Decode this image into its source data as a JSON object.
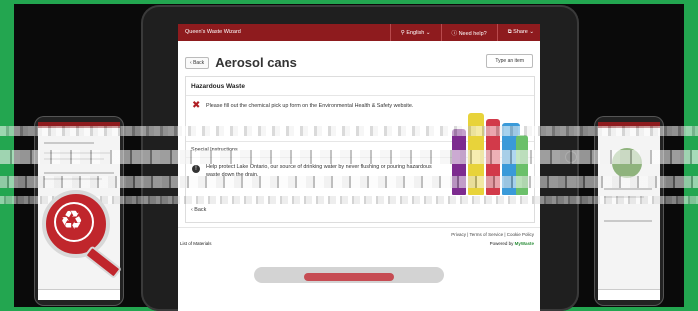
{
  "app": {
    "brand": "Queen's Waste Wizard",
    "language": "English",
    "help": "Need help?",
    "share": "Share"
  },
  "page": {
    "back_label": "Back",
    "title": "Aerosol cans",
    "type_an_item": "Type an item"
  },
  "card": {
    "section_title": "Hazardous Waste",
    "hazard_text": "Please fill out the chemical pick up form on the Environmental Health & Safety website.",
    "special_instructions": "Special Instructions",
    "info_text": "Help protect Lake Ontario, our source of drinking water by never flushing or pouring hazardous waste down the drain.",
    "back_link": "Back"
  },
  "footer": {
    "links": "Privacy | Terms of Service | Cookie Policy",
    "list_of_materials": "List of Materials",
    "powered_prefix": "Powered by",
    "powered_brand": "MyWaste"
  },
  "icons": {
    "hazard": "hazard-x-icon",
    "info": "info-icon",
    "recycle_search": "recycle-search-icon"
  },
  "colors": {
    "brand_red": "#8e1b1e",
    "accent_green": "#23a650",
    "badge_red": "#c0262c"
  }
}
